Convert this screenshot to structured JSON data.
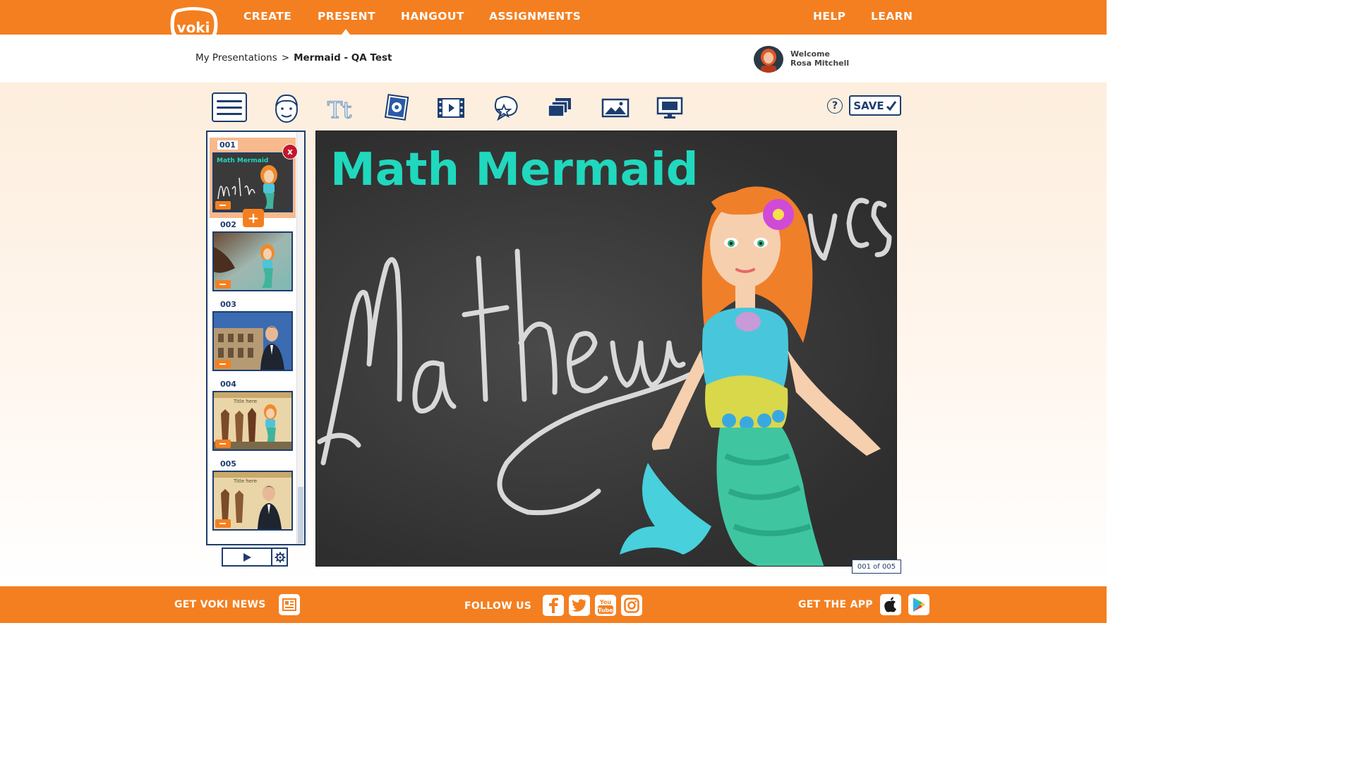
{
  "nav": {
    "logo_text": "voki",
    "links": [
      "CREATE",
      "PRESENT",
      "HANGOUT",
      "ASSIGNMENTS"
    ],
    "right_links": [
      "HELP",
      "LEARN"
    ],
    "active": "PRESENT"
  },
  "breadcrumb": {
    "root": "My Presentations",
    "separator": ">",
    "current": "Mermaid - QA Test"
  },
  "user": {
    "welcome": "Welcome",
    "name": "Rosa Mitchell"
  },
  "toolbar": {
    "tools": [
      "menu-icon",
      "character-icon",
      "text-icon",
      "sticker-icon",
      "video-icon",
      "star-bubble-icon",
      "layers-icon",
      "image-icon",
      "monitor-icon"
    ],
    "help_label": "?",
    "save_label": "SAVE"
  },
  "slides": [
    {
      "number": "001",
      "title": "Math Mermaid",
      "selected": true
    },
    {
      "number": "002"
    },
    {
      "number": "003"
    },
    {
      "number": "004",
      "title": "Title here"
    },
    {
      "number": "005",
      "title": "Title here"
    }
  ],
  "slide_actions": {
    "delete_label": "x",
    "add_label": "+"
  },
  "canvas": {
    "title": "Math Mermaid",
    "chalk_text": "Mathematics"
  },
  "page_counter": "001 of 005",
  "footer": {
    "news_label": "GET VOKI NEWS",
    "follow_label": "FOLLOW US",
    "app_label": "GET THE APP",
    "social": [
      "facebook-icon",
      "twitter-icon",
      "youtube-icon",
      "instagram-icon"
    ],
    "youtube_text": "You Tube",
    "stores": [
      "apple-icon",
      "google-play-icon"
    ]
  },
  "colors": {
    "brand_orange": "#f47f20",
    "navy": "#1d3d6e",
    "title_teal": "#20d8bd",
    "delete_red": "#c0182a"
  }
}
